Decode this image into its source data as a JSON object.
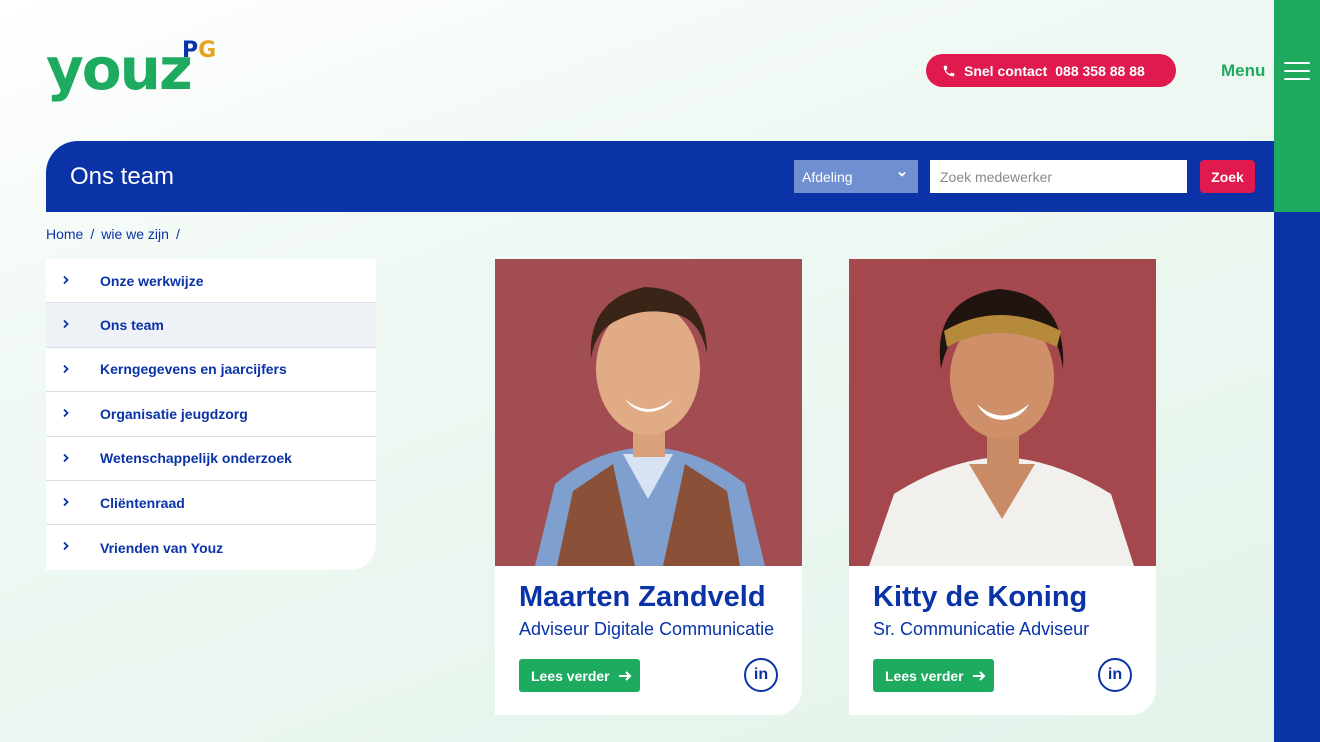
{
  "brand": {
    "logo_text": "youz",
    "logo_badge_p": "P",
    "logo_badge_g": "G",
    "green": "#1eaa5f",
    "blue": "#0a33a8",
    "red": "#e01a4f"
  },
  "header": {
    "contact_label": "Snel contact",
    "contact_phone": "088 358 88 88",
    "menu_label": "Menu"
  },
  "titlebar": {
    "title": "Ons team",
    "department_select": "Afdeling",
    "search_placeholder": "Zoek medewerker",
    "search_button": "Zoek"
  },
  "breadcrumb": {
    "items": [
      "Home",
      "wie we zijn"
    ],
    "separator": "/"
  },
  "sidenav": {
    "items": [
      {
        "label": "Onze werkwijze"
      },
      {
        "label": "Ons team"
      },
      {
        "label": "Kerngegevens en jaarcijfers"
      },
      {
        "label": "Organisatie jeugdzorg"
      },
      {
        "label": "Wetenschappelijk onderzoek"
      },
      {
        "label": "Cliëntenraad"
      },
      {
        "label": "Vrienden van Youz"
      }
    ]
  },
  "team": [
    {
      "name": "Maarten Zandveld",
      "role": "Adviseur Digitale Communicatie",
      "button": "Lees verder",
      "linkedin": "in"
    },
    {
      "name": "Kitty de Koning",
      "role": "Sr. Communicatie Adviseur",
      "button": "Lees verder",
      "linkedin": "in"
    }
  ]
}
